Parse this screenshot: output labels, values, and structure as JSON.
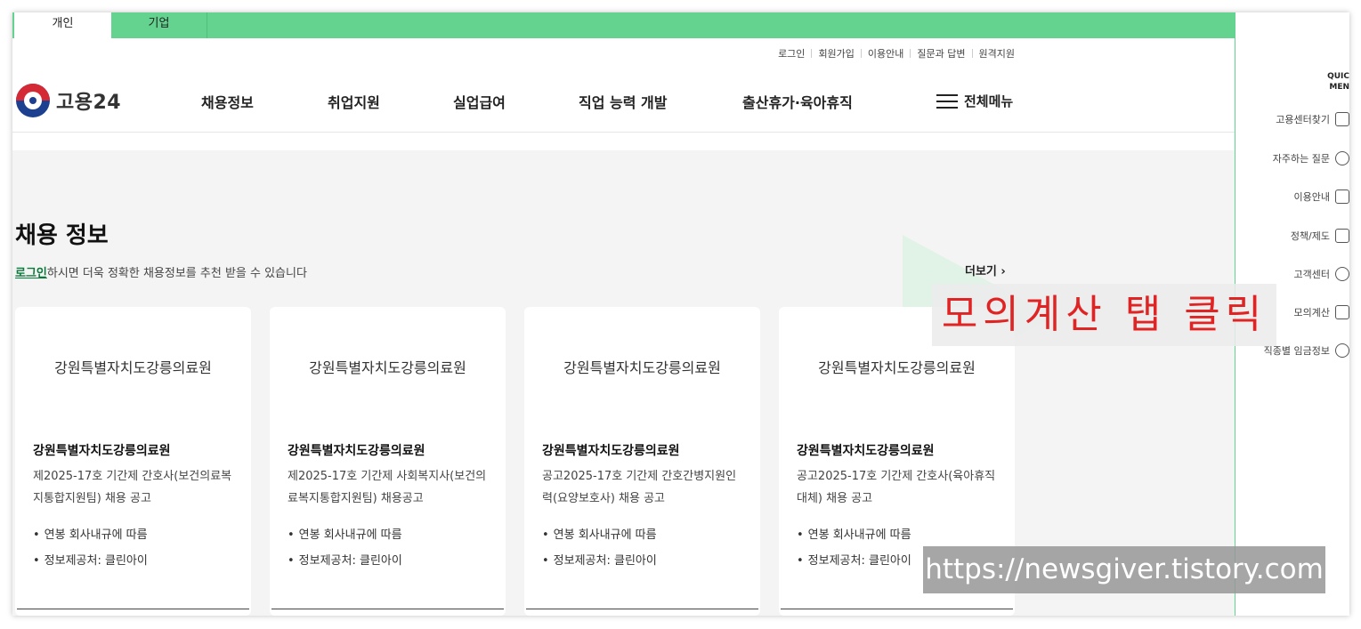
{
  "audience_tabs": [
    {
      "label": "개인",
      "active": true
    },
    {
      "label": "기업",
      "active": false
    }
  ],
  "utility_links": [
    "로그인",
    "회원가입",
    "이용안내",
    "질문과 답변",
    "원격지원"
  ],
  "logo": {
    "text": "고용24"
  },
  "nav": [
    "채용정보",
    "취업지원",
    "실업급여",
    "직업 능력 개발",
    "출산휴가·육아휴직"
  ],
  "menu_all": "전체메뉴",
  "section": {
    "title": "채용 정보",
    "desc_link": "로그인",
    "desc_rest": "하시면 더욱 정확한 채용정보를 추천 받을 수 있습니다",
    "more": "더보기 ›"
  },
  "cards": [
    {
      "org_logo": "강원특별자치도강릉의료원",
      "org": "강원특별자치도강릉의료원",
      "title": "제2025-17호 기간제 간호사(보건의료복지통합지원팀) 채용 공고",
      "salary": "연봉 회사내규에 따름",
      "source": "정보제공처: 클린아이"
    },
    {
      "org_logo": "강원특별자치도강릉의료원",
      "org": "강원특별자치도강릉의료원",
      "title": "제2025-17호 기간제 사회복지사(보건의료복지통합지원팀) 채용공고",
      "salary": "연봉 회사내규에 따름",
      "source": "정보제공처: 클린아이"
    },
    {
      "org_logo": "강원특별자치도강릉의료원",
      "org": "강원특별자치도강릉의료원",
      "title": "공고2025-17호 기간제 간호간병지원인력(요양보호사) 채용 공고",
      "salary": "연봉 회사내규에 따름",
      "source": "정보제공처: 클린아이"
    },
    {
      "org_logo": "강원특별자치도강릉의료원",
      "org": "강원특별자치도강릉의료원",
      "title": "공고2025-17호 기간제 간호사(육아휴직대체) 채용 공고",
      "salary": "연봉 회사내규에 따름",
      "source": "정보제공처: 클린아이"
    }
  ],
  "quick_menu": {
    "title_line1": "QUIC",
    "title_line2": "MEN",
    "items": [
      {
        "label": "고용센터찾기",
        "icon": "building-icon"
      },
      {
        "label": "자주하는 질문",
        "icon": "chat-bubble-icon"
      },
      {
        "label": "이용안내",
        "icon": "monitor-icon"
      },
      {
        "label": "정책/제도",
        "icon": "checklist-icon"
      },
      {
        "label": "고객센터",
        "icon": "smile-icon"
      },
      {
        "label": "모의계산",
        "icon": "calculator-icon"
      },
      {
        "label": "직종별 임금정보",
        "icon": "coins-icon"
      }
    ]
  },
  "annotation": "모의계산 탭 클릭",
  "watermark": "https://newsgiver.tistory.com",
  "colors": {
    "brand_green": "#64d38f",
    "annotation_red": "#e02424"
  }
}
